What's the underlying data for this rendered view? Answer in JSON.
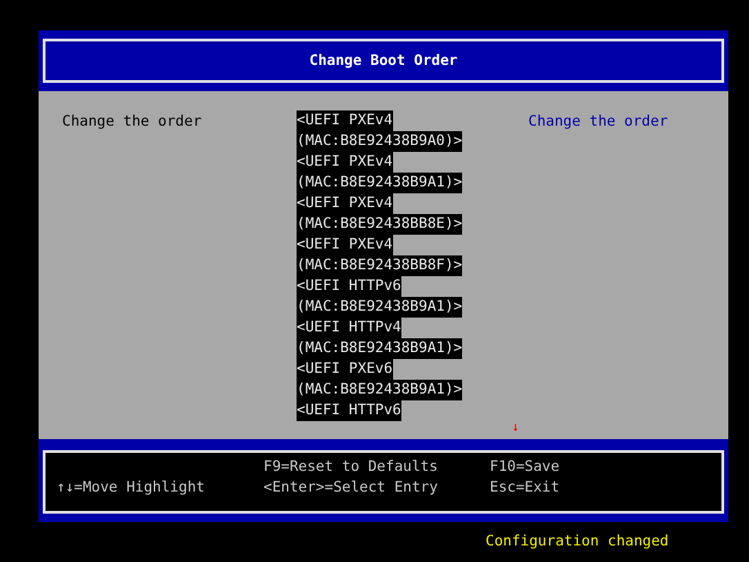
{
  "window": {
    "title": "Change Boot Order"
  },
  "prompt": "Change the order",
  "entries": [
    {
      "text": "<UEFI PXEv4"
    },
    {
      "text": "(MAC:B8E92438B9A0)>"
    },
    {
      "text": "<UEFI PXEv4"
    },
    {
      "text": "(MAC:B8E92438B9A1)>"
    },
    {
      "text": "<UEFI PXEv4"
    },
    {
      "text": "(MAC:B8E92438BB8E)>"
    },
    {
      "text": "<UEFI PXEv4"
    },
    {
      "text": "(MAC:B8E92438BB8F)>"
    },
    {
      "text": "<UEFI HTTPv6"
    },
    {
      "text": "(MAC:B8E92438B9A1)>"
    },
    {
      "text": "<UEFI HTTPv4"
    },
    {
      "text": "(MAC:B8E92438B9A1)>"
    },
    {
      "text": "<UEFI PXEv6"
    },
    {
      "text": "(MAC:B8E92438B9A1)>"
    },
    {
      "text": "<UEFI HTTPv6"
    }
  ],
  "help_text": "Change the order",
  "more_indicator": "↓",
  "footer": {
    "column_1": [
      "↑↓=Move Highlight"
    ],
    "column_2": [
      "F9=Reset to Defaults",
      "<Enter>=Select Entry"
    ],
    "column_3": [
      "F10=Save",
      "Esc=Exit"
    ]
  },
  "status": "Configuration changed"
}
